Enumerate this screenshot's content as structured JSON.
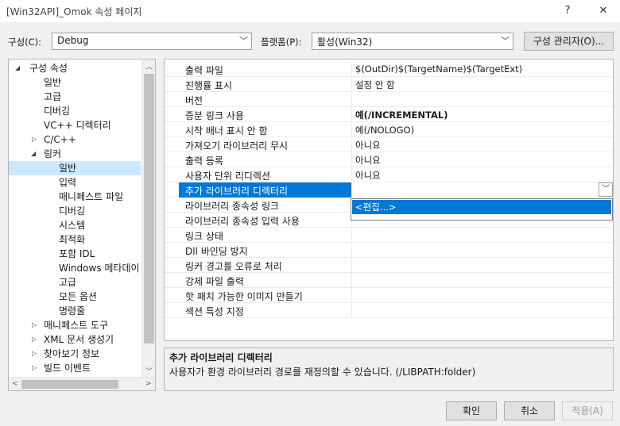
{
  "window": {
    "title": "[Win32API]_Omok 속성 페이지",
    "help_glyph": "?",
    "close_glyph": "✕"
  },
  "toolbar": {
    "config_label": "구성(C):",
    "config_value": "Debug",
    "platform_label": "플랫폼(P):",
    "platform_value": "활성(Win32)",
    "config_manager_label": "구성 관리자(O)..."
  },
  "tree": {
    "items": [
      {
        "label": "구성 속성"
      },
      {
        "label": "일반"
      },
      {
        "label": "고급"
      },
      {
        "label": "디버깅"
      },
      {
        "label": "VC++ 디렉터리"
      },
      {
        "label": "C/C++"
      },
      {
        "label": "링커"
      },
      {
        "label": "일반"
      },
      {
        "label": "입력"
      },
      {
        "label": "매니페스트 파일"
      },
      {
        "label": "디버깅"
      },
      {
        "label": "시스템"
      },
      {
        "label": "최적화"
      },
      {
        "label": "포함 IDL"
      },
      {
        "label": "Windows 메타데이"
      },
      {
        "label": "고급"
      },
      {
        "label": "모든 옵션"
      },
      {
        "label": "명령줄"
      },
      {
        "label": "매니페스트 도구"
      },
      {
        "label": "XML 문서 생성기"
      },
      {
        "label": "찾아보기 정보"
      },
      {
        "label": "빌드 이벤트"
      }
    ]
  },
  "grid": {
    "rows": [
      {
        "name": "출력 파일",
        "value": "$(OutDir)$(TargetName)$(TargetExt)"
      },
      {
        "name": "진행률 표시",
        "value": "설정 안 함"
      },
      {
        "name": "버전",
        "value": ""
      },
      {
        "name": "증분 링크 사용",
        "value": "예(/INCREMENTAL)"
      },
      {
        "name": "시작 배너 표시 안 함",
        "value": "예(/NOLOGO)"
      },
      {
        "name": "가져오기 라이브러리 무시",
        "value": "아니요"
      },
      {
        "name": "출력 등록",
        "value": "아니요"
      },
      {
        "name": "사용자 단위 리디렉션",
        "value": "아니요"
      },
      {
        "name": "추가 라이브러리 디렉터리",
        "value": ""
      },
      {
        "name": "라이브러리 종속성 링크",
        "value": ""
      },
      {
        "name": "라이브러리 종속성 입력 사용",
        "value": ""
      },
      {
        "name": "링크 상태",
        "value": ""
      },
      {
        "name": "Dll 바인딩 방지",
        "value": ""
      },
      {
        "name": "링커 경고를 오류로 처리",
        "value": ""
      },
      {
        "name": "강제 파일 출력",
        "value": ""
      },
      {
        "name": "핫 패치 가능한 이미지 만들기",
        "value": ""
      },
      {
        "name": "섹션 특성 지정",
        "value": ""
      }
    ],
    "dropdown_option": "<편집...>"
  },
  "description": {
    "title": "추가 라이브러리 디렉터리",
    "text": "사용자가 환경 라이브러리 경로를 재정의할 수 있습니다. (/LIBPATH:folder)"
  },
  "buttons": {
    "ok": "확인",
    "cancel": "취소",
    "apply": "적용(A)"
  },
  "colors": {
    "selection_blue": "#0078d7",
    "tree_selection": "#cce8ff"
  }
}
